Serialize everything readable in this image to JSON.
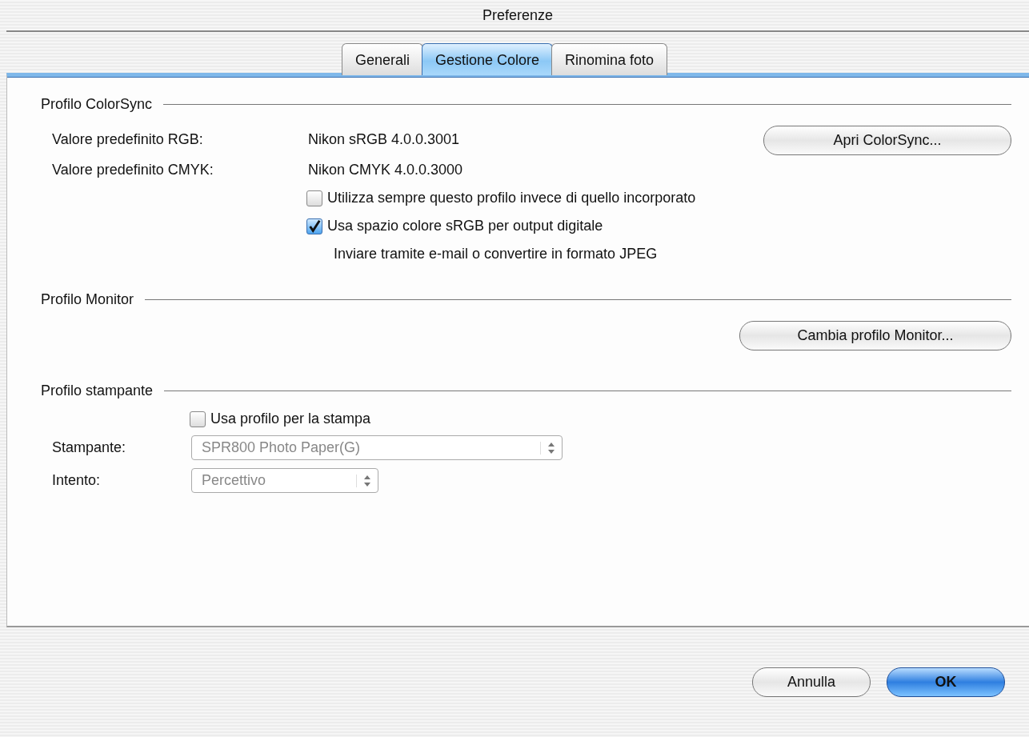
{
  "window": {
    "title": "Preferenze"
  },
  "tabs": [
    {
      "label": "Generali",
      "selected": false
    },
    {
      "label": "Gestione Colore",
      "selected": true
    },
    {
      "label": "Rinomina foto",
      "selected": false
    }
  ],
  "colorsync": {
    "title": "Profilo ColorSync",
    "defaults": [
      {
        "label": "Valore predefinito RGB:",
        "value": "Nikon sRGB 4.0.0.3001"
      },
      {
        "label": "Valore predefinito CMYK:",
        "value": "Nikon CMYK 4.0.0.3000"
      }
    ],
    "button": "Apri ColorSync...",
    "options": [
      {
        "label": "Utilizza sempre questo profilo invece di quello incorporato",
        "checked": false
      },
      {
        "label": "Usa spazio colore sRGB per output digitale",
        "checked": true
      }
    ],
    "note": "Inviare tramite e-mail o convertire in formato JPEG"
  },
  "monitor": {
    "title": "Profilo Monitor",
    "button": "Cambia profilo Monitor..."
  },
  "printer": {
    "title": "Profilo stampante",
    "option": {
      "label": "Usa profilo per la stampa",
      "checked": false
    },
    "fields": [
      {
        "label": "Stampante:",
        "value": "SPR800 Photo Paper(G)",
        "disabled": true
      },
      {
        "label": "Intento:",
        "value": "Percettivo",
        "disabled": true
      }
    ]
  },
  "buttons": [
    {
      "label": "Annulla",
      "default": false
    },
    {
      "label": "OK",
      "default": true
    }
  ]
}
